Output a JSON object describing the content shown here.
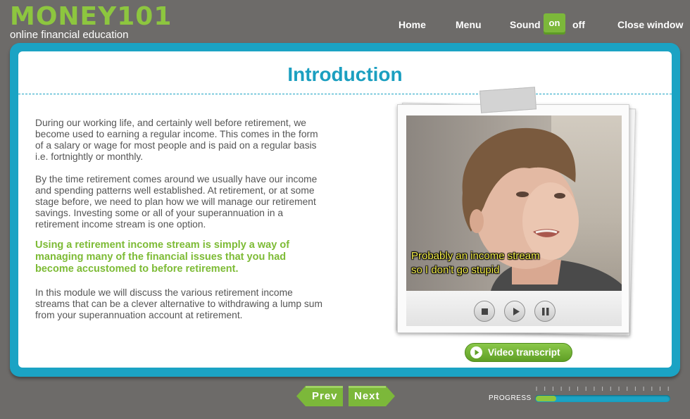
{
  "header": {
    "logo_word": "MONEY101",
    "logo_subtitle": "online financial education",
    "nav": {
      "home": "Home",
      "menu": "Menu",
      "sound_label": "Sound",
      "sound_on": "on",
      "sound_off": "off",
      "close": "Close window"
    }
  },
  "main": {
    "title": "Introduction",
    "para1": "During our working life, and certainly well before retirement, we become used to earning a regular income. This comes in the form of a salary or wage for most people and is paid on a regular basis i.e. fortnightly or monthly.",
    "para2": "By the time retirement comes around we usually have our income and spending patterns well established. At retirement, or at some stage before, we need to plan how we will manage our retirement savings. Investing some or all of your superannuation in a retirement income stream is one option.",
    "highlight": "Using a retirement income stream is simply a way of managing many of the financial issues that you had become accustomed to before retirement.",
    "para3": "In this module we will discuss the various retirement income streams that can be a clever alternative to withdrawing a lump sum from your superannuation account at retirement."
  },
  "video": {
    "caption_line1": "Probably an income stream",
    "caption_line2": "so I don't go stupid",
    "controls": [
      "stop-icon",
      "play-icon",
      "pause-icon"
    ],
    "transcript_label": "Video transcript"
  },
  "footer": {
    "prev_label": "Prev",
    "next_label": "Next",
    "progress_label": "PROGRESS",
    "progress_fraction": 0.15
  },
  "colors": {
    "accent_blue": "#1ba3c4",
    "accent_green": "#8dc63f",
    "background": "#6d6b69",
    "caption_yellow": "#f5ef4d"
  }
}
